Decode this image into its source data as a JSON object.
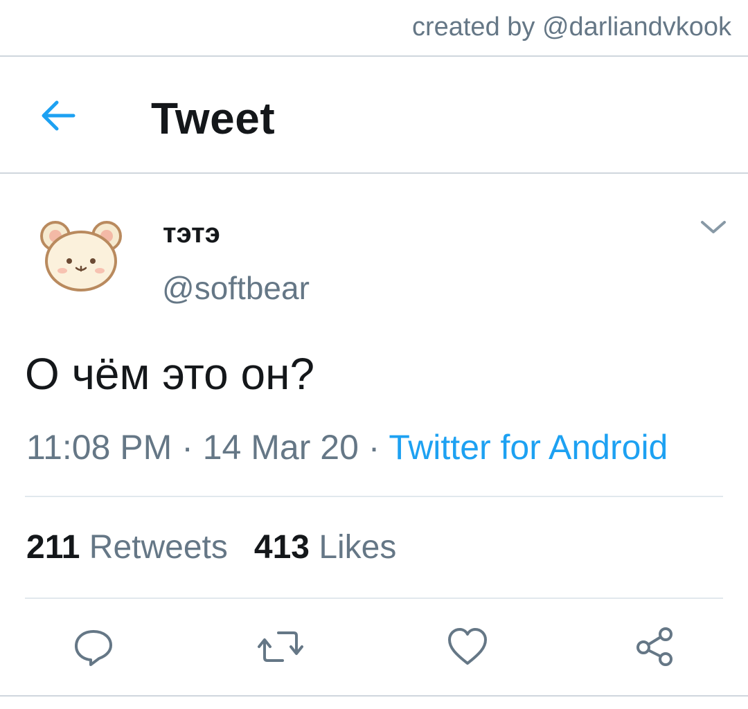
{
  "watermark": "created by @darliandvkook",
  "header": {
    "title": "Tweet"
  },
  "tweet": {
    "display_name": "тэтэ",
    "handle": "@softbear",
    "text": "О чём это он?",
    "time": "11:08 PM",
    "date": "14 Mar 20",
    "separator": " · ",
    "source": "Twitter for Android",
    "retweet_count": "211",
    "retweet_label": "Retweets",
    "like_count": "413",
    "like_label": "Likes"
  },
  "icons": {
    "back": "arrow-left-icon",
    "menu": "chevron-down-icon",
    "reply": "reply-icon",
    "retweet": "retweet-icon",
    "like": "heart-icon",
    "share": "share-icon"
  },
  "colors": {
    "accent": "#1da1f2",
    "text": "#14171a",
    "secondary": "#657786",
    "divider": "#e1e8ed"
  }
}
